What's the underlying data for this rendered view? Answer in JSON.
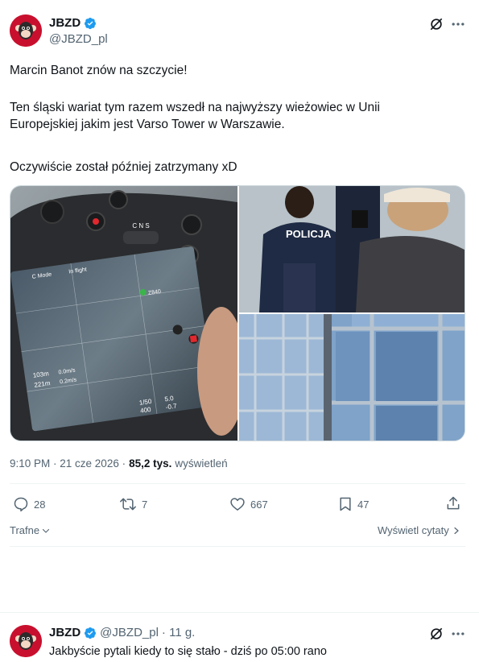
{
  "main_tweet": {
    "author_name": "JBZD",
    "author_handle": "@JBZD_pl",
    "text_lines": [
      "Marcin Banot znów na szczycie!",
      "Ten śląski wariat tym razem wszedł na najwyższy wieżowiec w Unii Europejskiej jakim jest Varso Tower w Warszawie.",
      "Oczywiście został później zatrzymany xD"
    ],
    "timestamp": "9:10 PM · 21 cze 2026 ·",
    "views_count": "85,2 tys.",
    "views_label": "wyświetleń",
    "actions": {
      "replies": "28",
      "retweets": "7",
      "likes": "667",
      "bookmarks": "47"
    },
    "sort_label": "Trafne",
    "quotes_link": "Wyświetl cytaty"
  },
  "media": {
    "controller_labels": {
      "mode": "C Mode",
      "flight": "In flight",
      "cns": "C N S",
      "height": "103m",
      "height_speed": "0.0m/s",
      "distance": "221m",
      "distance_speed": "0.2m/s",
      "shutter": "1/50",
      "aperture": "5.0",
      "iso": "400",
      "ev": "-0.7",
      "batt": "Z840"
    },
    "police_vest_text": "POLICJA"
  },
  "reply_tweet": {
    "author_name": "JBZD",
    "author_handle": "@JBZD_pl",
    "time_ago": "· 11 g.",
    "text": "Jakbyście pytali kiedy to się stało - dziś po 05:00 rano"
  },
  "colors": {
    "verified": "#1d9bf0",
    "avatar": "#c8102e",
    "muted": "#536471"
  }
}
